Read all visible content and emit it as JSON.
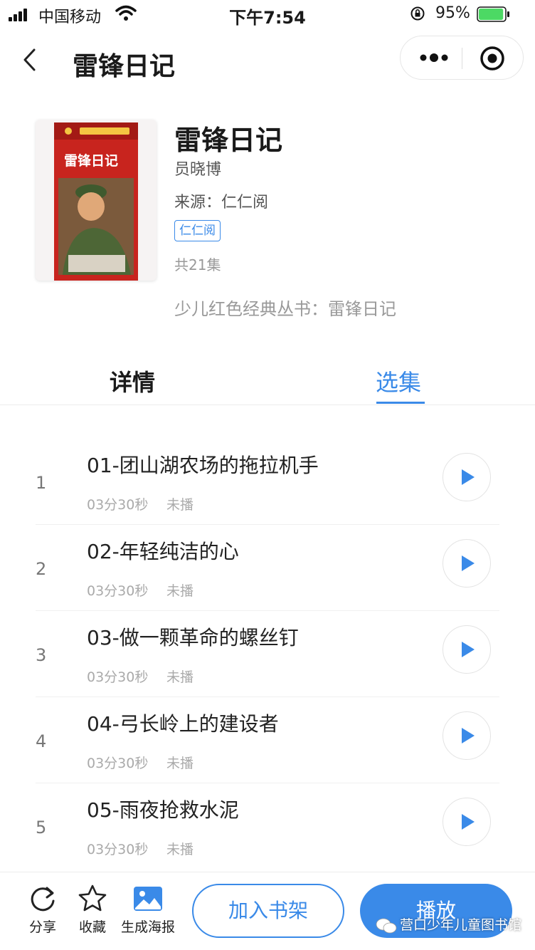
{
  "status_bar": {
    "carrier": "中国移动",
    "time": "下午7:54",
    "battery_percent": "95%",
    "battery_level": 0.95
  },
  "nav": {
    "title": "雷锋日记"
  },
  "book": {
    "title": "雷锋日记",
    "author": "员晓博",
    "source": "来源：仁仁阅",
    "tag": "仁仁阅",
    "episode_count": "共21集",
    "series": "少儿红色经典丛书：雷锋日记",
    "cover_title": "雷锋日记"
  },
  "tabs": [
    {
      "label": "详情",
      "active": false
    },
    {
      "label": "选集",
      "active": true
    }
  ],
  "episodes": [
    {
      "num": "1",
      "title": "01-团山湖农场的拖拉机手",
      "duration": "03分30秒",
      "status": "未播"
    },
    {
      "num": "2",
      "title": "02-年轻纯洁的心",
      "duration": "03分30秒",
      "status": "未播"
    },
    {
      "num": "3",
      "title": "03-做一颗革命的螺丝钉",
      "duration": "03分30秒",
      "status": "未播"
    },
    {
      "num": "4",
      "title": "04-弓长岭上的建设者",
      "duration": "03分30秒",
      "status": "未播"
    },
    {
      "num": "5",
      "title": "05-雨夜抢救水泥",
      "duration": "03分30秒",
      "status": "未播"
    }
  ],
  "bottom_bar": {
    "share_label": "分享",
    "favorite_label": "收藏",
    "poster_label": "生成海报",
    "add_shelf_label": "加入书架",
    "play_label": "播放"
  },
  "watermark": "营口少年儿童图书馆",
  "colors": {
    "accent": "#3a8ae8",
    "battery": "#4cd964",
    "cover_red": "#c8241e"
  },
  "icons": {
    "back": "chevron-left-icon",
    "more": "more-dots-icon",
    "target": "target-icon",
    "play": "play-icon",
    "share": "share-icon",
    "favorite": "star-icon",
    "poster": "image-icon"
  }
}
